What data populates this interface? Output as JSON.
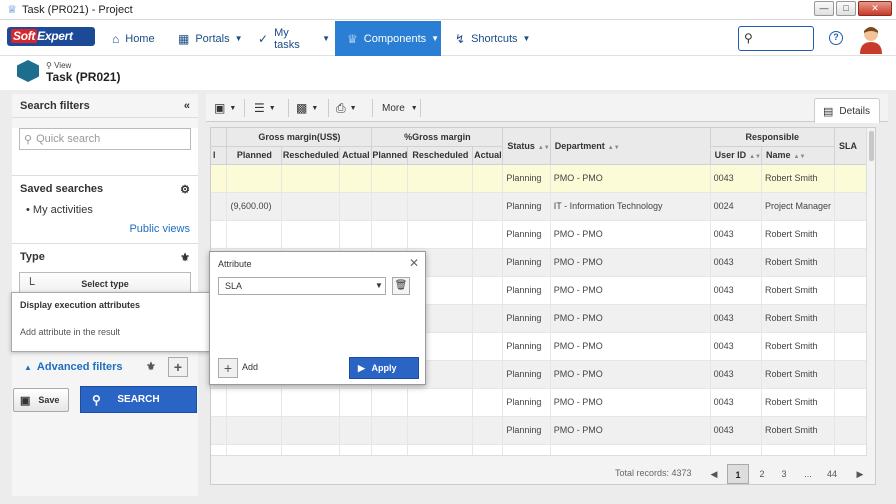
{
  "window": {
    "title": "Task (PR021) - Project"
  },
  "nav": {
    "logo_text": "SoftExpert",
    "items": [
      {
        "label": "Home",
        "icon": "home-icon",
        "caret": false,
        "active": false
      },
      {
        "label": "Portals",
        "icon": "portals-icon",
        "caret": true,
        "active": false
      },
      {
        "label": "My tasks",
        "icon": "check-icon",
        "caret": true,
        "active": false
      },
      {
        "label": "Components",
        "icon": "trophy-icon",
        "caret": true,
        "active": true
      },
      {
        "label": "Shortcuts",
        "icon": "bolt-icon",
        "caret": true,
        "active": false
      }
    ],
    "help": "?"
  },
  "page": {
    "view_label": "View",
    "title": "Task (PR021)"
  },
  "filters": {
    "header": "Search filters",
    "quick_search_placeholder": "Quick search",
    "saved_searches_label": "Saved searches",
    "saved_items": [
      "My activities"
    ],
    "public_views": "Public views",
    "type_label": "Type",
    "select_type": "Select type",
    "advanced_filters": "Advanced filters",
    "save": "Save",
    "search": "SEARCH"
  },
  "toolbar": {
    "more": "More",
    "details": "Details"
  },
  "grid": {
    "group_headers": [
      "Gross margin(US$)",
      "%Gross margin",
      "Responsible"
    ],
    "columns": [
      "l",
      "Planned",
      "Rescheduled",
      "Actual",
      "Planned",
      "Rescheduled",
      "Actual",
      "Status",
      "Department",
      "User ID",
      "Name",
      "SLA"
    ],
    "rows": [
      {
        "planned": "",
        "status": "Planning",
        "department": "PMO - PMO",
        "user_id": "0043",
        "name": "Robert Smith"
      },
      {
        "planned": "(9,600.00)",
        "status": "Planning",
        "department": "IT - Information Technology",
        "user_id": "0024",
        "name": "Project Manager"
      },
      {
        "planned": "",
        "status": "Planning",
        "department": "PMO - PMO",
        "user_id": "0043",
        "name": "Robert Smith"
      },
      {
        "planned": "",
        "status": "Planning",
        "department": "PMO - PMO",
        "user_id": "0043",
        "name": "Robert Smith"
      },
      {
        "planned": "",
        "status": "Planning",
        "department": "PMO - PMO",
        "user_id": "0043",
        "name": "Robert Smith"
      },
      {
        "planned": "",
        "status": "Planning",
        "department": "PMO - PMO",
        "user_id": "0043",
        "name": "Robert Smith"
      },
      {
        "planned": "",
        "status": "Planning",
        "department": "PMO - PMO",
        "user_id": "0043",
        "name": "Robert Smith"
      },
      {
        "planned": "",
        "status": "Planning",
        "department": "PMO - PMO",
        "user_id": "0043",
        "name": "Robert Smith"
      },
      {
        "planned": "",
        "status": "Planning",
        "department": "PMO - PMO",
        "user_id": "0043",
        "name": "Robert Smith"
      },
      {
        "planned": "",
        "status": "Planning",
        "department": "PMO - PMO",
        "user_id": "0043",
        "name": "Robert Smith"
      },
      {
        "planned": "",
        "status": "",
        "department": "",
        "user_id": "",
        "name": ""
      }
    ],
    "highlight_row": 0
  },
  "pagination": {
    "total": "Total records: 4373",
    "pages": [
      "1",
      "2",
      "3",
      "...",
      "44"
    ],
    "current": "1"
  },
  "exec_panel": {
    "title": "Display execution attributes",
    "hint": "Add attribute in the result"
  },
  "attribute_popup": {
    "title": "Attribute",
    "selected": "SLA",
    "add_label": "Add",
    "apply": "Apply"
  },
  "colors": {
    "accent": "#2a7fd4",
    "button_blue": "#2a64c5",
    "highlight_row": "#fbfbd8",
    "link": "#1e6fc0"
  }
}
